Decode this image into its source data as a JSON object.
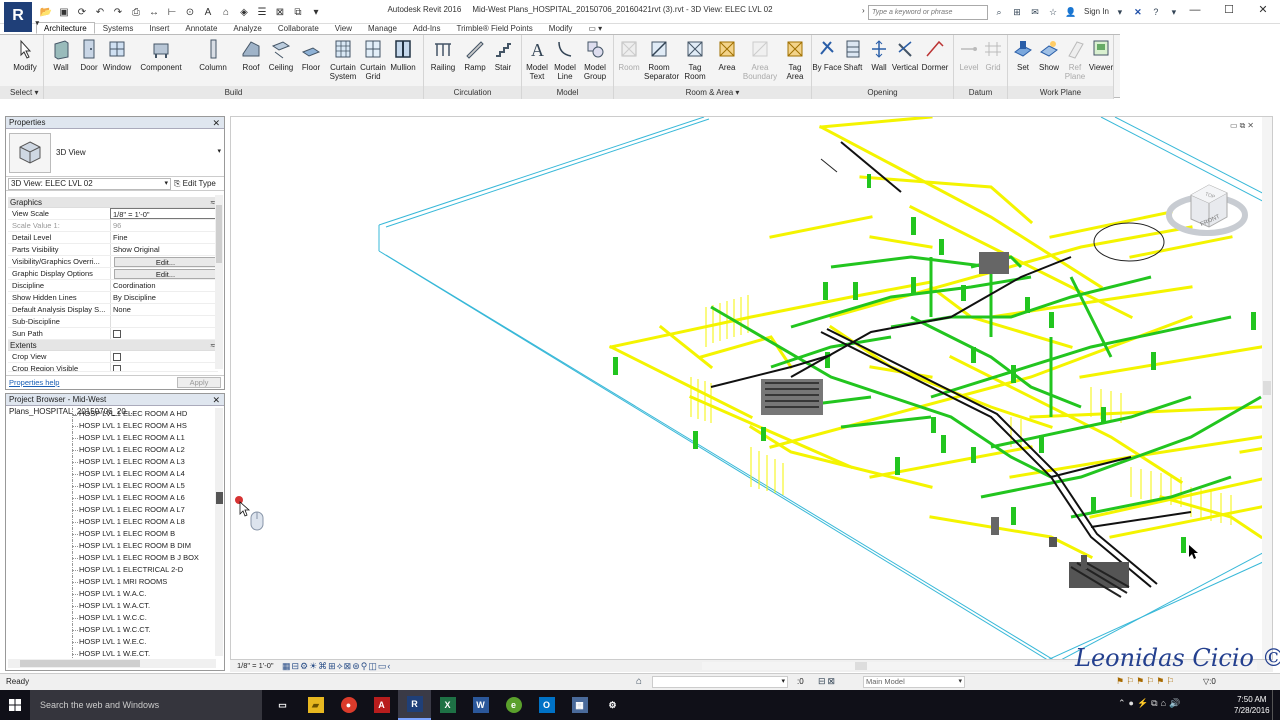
{
  "app": {
    "logo": "R",
    "title_product": "Autodesk Revit 2016",
    "title_document": "Mid-West Plans_HOSPITAL_20150706_20160421rvt (3).rvt - 3D View: ELEC LVL 02",
    "search_placeholder": "Type a keyword or phrase",
    "sign_in": "Sign In"
  },
  "tabs": [
    "Architecture",
    "Systems",
    "Insert",
    "Annotate",
    "Analyze",
    "Collaborate",
    "View",
    "Manage",
    "Add-Ins",
    "Trimble® Field Points",
    "Modify",
    "▭ ▾"
  ],
  "ribbon": {
    "select_label": "Select ▾",
    "groups": {
      "build": "Build",
      "circulation": "Circulation",
      "model": "Model",
      "room_area": "Room & Area ▾",
      "opening": "Opening",
      "datum": "Datum",
      "work_plane": "Work Plane"
    },
    "buttons": {
      "modify": "Modify",
      "wall": "Wall",
      "door": "Door",
      "window": "Window",
      "component": "Component",
      "column": "Column",
      "roof": "Roof",
      "ceiling": "Ceiling",
      "floor": "Floor",
      "curtain_system": "Curtain System",
      "curtain_grid": "Curtain Grid",
      "mullion": "Mullion",
      "railing": "Railing",
      "ramp": "Ramp",
      "stair": "Stair",
      "model_text": "Model Text",
      "model_line": "Model Line",
      "model_group": "Model Group",
      "room": "Room",
      "room_separator": "Room Separator",
      "tag_room": "Tag Room",
      "area": "Area",
      "area_boundary": "Area Boundary",
      "tag_area": "Tag Area",
      "by_face": "By Face",
      "shaft": "Shaft",
      "wall_opening": "Wall",
      "vertical": "Vertical",
      "dormer": "Dormer",
      "level": "Level",
      "grid": "Grid",
      "set": "Set",
      "show": "Show",
      "ref_plane": "Ref Plane",
      "viewer": "Viewer"
    }
  },
  "properties": {
    "title": "Properties",
    "type_name": "3D View",
    "view_selector": "3D View: ELEC LVL 02",
    "edit_type": "Edit Type",
    "sections": {
      "graphics": "Graphics",
      "extents": "Extents"
    },
    "rows": [
      {
        "name": "View Scale",
        "value": "1/8\" = 1'-0\""
      },
      {
        "name": "Scale Value    1:",
        "value": "96"
      },
      {
        "name": "Detail Level",
        "value": "Fine"
      },
      {
        "name": "Parts Visibility",
        "value": "Show Original"
      },
      {
        "name": "Visibility/Graphics Overri...",
        "value": "Edit..."
      },
      {
        "name": "Graphic Display Options",
        "value": "Edit..."
      },
      {
        "name": "Discipline",
        "value": "Coordination"
      },
      {
        "name": "Show Hidden Lines",
        "value": "By Discipline"
      },
      {
        "name": "Default Analysis Display S...",
        "value": "None"
      },
      {
        "name": "Sub-Discipline",
        "value": ""
      },
      {
        "name": "Sun Path",
        "value": ""
      }
    ],
    "extents_rows": [
      {
        "name": "Crop View",
        "value": ""
      },
      {
        "name": "Crop Region Visible",
        "value": ""
      }
    ],
    "help_link": "Properties help",
    "apply": "Apply"
  },
  "browser": {
    "title": "Project Browser - Mid-West Plans_HOSPITAL_20150706_20...",
    "items": [
      "HOSP LVL 1 ELEC ROOM A HD",
      "HOSP LVL 1 ELEC ROOM A HS",
      "HOSP LVL 1 ELEC ROOM A L1",
      "HOSP LVL 1 ELEC ROOM A L2",
      "HOSP LVL 1 ELEC ROOM A L3",
      "HOSP LVL 1 ELEC ROOM A L4",
      "HOSP LVL 1 ELEC ROOM A L5",
      "HOSP LVL 1 ELEC ROOM A L6",
      "HOSP LVL 1 ELEC ROOM A L7",
      "HOSP LVL 1 ELEC ROOM A L8",
      "HOSP LVL 1 ELEC ROOM B",
      "HOSP LVL 1 ELEC ROOM B DIM",
      "HOSP LVL 1 ELEC ROOM B J BOX",
      "HOSP LVL 1 ELECTRICAL 2-D",
      "HOSP LVL 1 MRI ROOMS",
      "HOSP LVL 1 W.A.C.",
      "HOSP LVL 1 W.A.CT.",
      "HOSP LVL 1 W.C.C.",
      "HOSP LVL 1 W.C.CT.",
      "HOSP LVL 1 W.E.C.",
      "HOSP LVL 1 W.E.CT."
    ]
  },
  "viewcube": {
    "face": "FRONT",
    "top": "TOP"
  },
  "view_control": {
    "scale": "1/8\" = 1'-0\""
  },
  "watermark": "Leonidas Cicio ©",
  "status": {
    "text": "Ready",
    "zero": ":0",
    "model": "Main Model",
    "filter": "▽:0"
  },
  "taskbar": {
    "search": "Search the web and Windows",
    "time": "7:50 AM",
    "date": "7/28/2016"
  },
  "colors": {
    "duct_yellow": "#f4f400",
    "pipe_green": "#22c51f",
    "ribbon_bg": "#f4f4f4",
    "taskbar_bg": "#101018",
    "revit_blue": "#1f3f78"
  }
}
